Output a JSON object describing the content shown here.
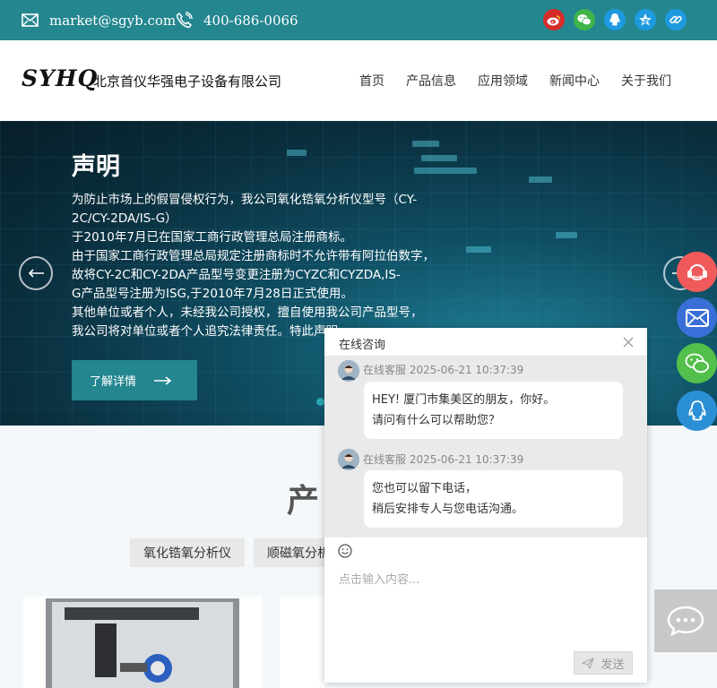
{
  "topbar": {
    "email": "market@sgyb.com",
    "phone": "400-686-0066",
    "social": [
      {
        "name": "weibo-icon",
        "color": "#d52c2b"
      },
      {
        "name": "wechat-icon",
        "color": "#3fb549"
      },
      {
        "name": "qq-icon",
        "color": "#1e9ae0"
      },
      {
        "name": "qzone-icon",
        "color": "#1e9ae0"
      },
      {
        "name": "share-link-icon",
        "color": "#1e9ae0"
      }
    ]
  },
  "header": {
    "logo_mark": "SYHQ",
    "company_name": "北京首仪华强电子设备有限公司",
    "nav": [
      "首页",
      "产品信息",
      "应用领域",
      "新闻中心",
      "关于我们"
    ]
  },
  "banner": {
    "title": "声明",
    "lines": [
      "为防止市场上的假冒侵权行为，我公司氧化锆氧分析仪型号（CY-",
      "2C/CY-2DA/IS-G）",
      "于2010年7月已在国家工商行政管理总局注册商标。",
      "由于国家工商行政管理总局规定注册商标时不允许带有阿拉伯数字，",
      "故将CY-2C和CY-2DA产品型号变更注册为CYZC和CYZDA,IS-",
      "G产品型号注册为ISG,于2010年7月28日正式使用。",
      "其他单位或者个人，未经我公司授权，擅自使用我公司产品型号，",
      "我公司将对单位或者个人追究法律责任。特此声明"
    ],
    "button": "了解详情"
  },
  "products": {
    "title": "产",
    "tabs": [
      "氧化锆氧分析仪",
      "顺磁氧分析"
    ]
  },
  "chat": {
    "title": "在线咨询",
    "messages": [
      {
        "sender": "在线客服",
        "time": "2025-06-21 10:37:39",
        "lines": [
          "HEY! 厦门市集美区的朋友，你好。",
          "请问有什么可以帮助您？"
        ]
      },
      {
        "sender": "在线客服",
        "time": "2025-06-21 10:37:39",
        "lines": [
          "您也可以留下电话，",
          "稍后安排专人与您电话沟通。"
        ]
      }
    ],
    "placeholder": "点击输入内容...",
    "send": "发送"
  },
  "float_icons": [
    {
      "name": "customer-service-icon",
      "color": "#f05a5a"
    },
    {
      "name": "mail-icon",
      "color": "#3a6fd8"
    },
    {
      "name": "wechat-float-icon",
      "color": "#52c04b"
    },
    {
      "name": "qq-float-icon",
      "color": "#2b8fd6"
    }
  ]
}
